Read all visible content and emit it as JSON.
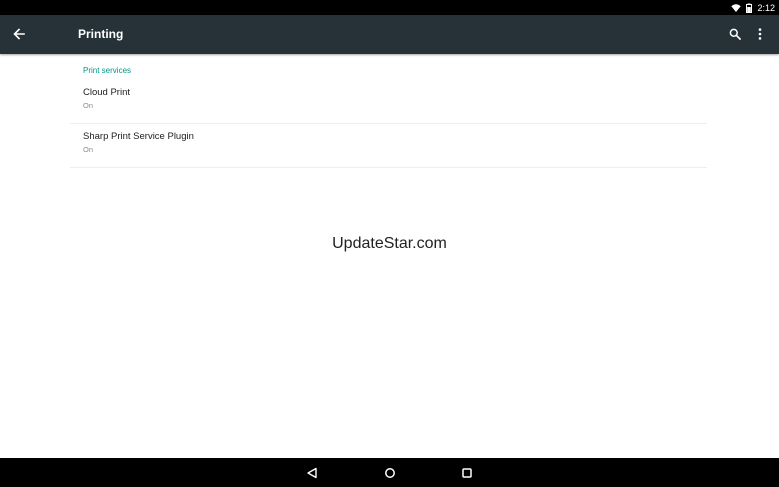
{
  "status_bar": {
    "time": "2:12",
    "icons": [
      "wifi-icon",
      "battery-icon"
    ]
  },
  "toolbar": {
    "title": "Printing",
    "back_icon": "arrow-back-icon",
    "search_icon": "search-icon",
    "more_icon": "more-vert-icon"
  },
  "print_services": {
    "header": "Print services",
    "items": [
      {
        "title": "Cloud Print",
        "summary": "On"
      },
      {
        "title": "Sharp Print Service Plugin",
        "summary": "On"
      }
    ]
  },
  "watermark": "UpdateStar.com",
  "nav_bar": {
    "icons": [
      "nav-back-icon",
      "nav-home-icon",
      "nav-recents-icon"
    ]
  },
  "colors": {
    "toolbar": "#263238",
    "accent": "#009688",
    "status_bar": "#000000",
    "nav_bar": "#000000"
  }
}
